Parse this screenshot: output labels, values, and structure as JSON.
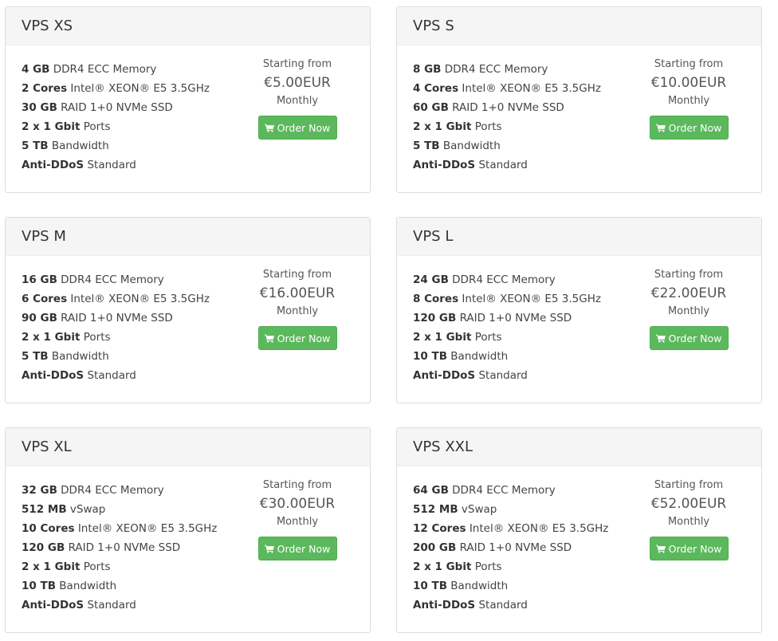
{
  "plans": [
    {
      "name": "VPS XS",
      "features": [
        {
          "value": "4 GB",
          "label": "DDR4 ECC Memory"
        },
        {
          "value": "2 Cores",
          "label": "Intel® XEON® E5 3.5GHz"
        },
        {
          "value": "30 GB",
          "label": "RAID 1+0 NVMe SSD"
        },
        {
          "value": "2 x 1 Gbit",
          "label": "Ports"
        },
        {
          "value": "5 TB",
          "label": "Bandwidth"
        },
        {
          "value": "Anti-DDoS",
          "label": "Standard"
        }
      ],
      "starting_from": "Starting from",
      "price": "€5.00EUR",
      "period": "Monthly",
      "order_label": "Order Now"
    },
    {
      "name": "VPS S",
      "features": [
        {
          "value": "8 GB",
          "label": "DDR4 ECC Memory"
        },
        {
          "value": "4 Cores",
          "label": "Intel® XEON® E5 3.5GHz"
        },
        {
          "value": "60 GB",
          "label": "RAID 1+0 NVMe SSD"
        },
        {
          "value": "2 x 1 Gbit",
          "label": "Ports"
        },
        {
          "value": "5 TB",
          "label": "Bandwidth"
        },
        {
          "value": "Anti-DDoS",
          "label": "Standard"
        }
      ],
      "starting_from": "Starting from",
      "price": "€10.00EUR",
      "period": "Monthly",
      "order_label": "Order Now"
    },
    {
      "name": "VPS M",
      "features": [
        {
          "value": "16 GB",
          "label": "DDR4 ECC Memory"
        },
        {
          "value": "6 Cores",
          "label": "Intel® XEON® E5 3.5GHz"
        },
        {
          "value": "90 GB",
          "label": "RAID 1+0 NVMe SSD"
        },
        {
          "value": "2 x 1 Gbit",
          "label": "Ports"
        },
        {
          "value": "5 TB",
          "label": "Bandwidth"
        },
        {
          "value": "Anti-DDoS",
          "label": "Standard"
        }
      ],
      "starting_from": "Starting from",
      "price": "€16.00EUR",
      "period": "Monthly",
      "order_label": "Order Now"
    },
    {
      "name": "VPS L",
      "features": [
        {
          "value": "24 GB",
          "label": "DDR4 ECC Memory"
        },
        {
          "value": "8 Cores",
          "label": "Intel® XEON® E5 3.5GHz"
        },
        {
          "value": "120 GB",
          "label": "RAID 1+0 NVMe SSD"
        },
        {
          "value": "2 x 1 Gbit",
          "label": "Ports"
        },
        {
          "value": "10 TB",
          "label": "Bandwidth"
        },
        {
          "value": "Anti-DDoS",
          "label": "Standard"
        }
      ],
      "starting_from": "Starting from",
      "price": "€22.00EUR",
      "period": "Monthly",
      "order_label": "Order Now"
    },
    {
      "name": "VPS XL",
      "features": [
        {
          "value": "32 GB",
          "label": "DDR4 ECC Memory"
        },
        {
          "value": "512 MB",
          "label": "vSwap"
        },
        {
          "value": "10 Cores",
          "label": "Intel® XEON® E5 3.5GHz"
        },
        {
          "value": "120 GB",
          "label": "RAID 1+0 NVMe SSD"
        },
        {
          "value": "2 x 1 Gbit",
          "label": "Ports"
        },
        {
          "value": "10 TB",
          "label": "Bandwidth"
        },
        {
          "value": "Anti-DDoS",
          "label": "Standard"
        }
      ],
      "starting_from": "Starting from",
      "price": "€30.00EUR",
      "period": "Monthly",
      "order_label": "Order Now"
    },
    {
      "name": "VPS XXL",
      "features": [
        {
          "value": "64 GB",
          "label": "DDR4 ECC Memory"
        },
        {
          "value": "512 MB",
          "label": "vSwap"
        },
        {
          "value": "12 Cores",
          "label": "Intel® XEON® E5 3.5GHz"
        },
        {
          "value": "200 GB",
          "label": "RAID 1+0 NVMe SSD"
        },
        {
          "value": "2 x 1 Gbit",
          "label": "Ports"
        },
        {
          "value": "10 TB",
          "label": "Bandwidth"
        },
        {
          "value": "Anti-DDoS",
          "label": "Standard"
        }
      ],
      "starting_from": "Starting from",
      "price": "€52.00EUR",
      "period": "Monthly",
      "order_label": "Order Now"
    }
  ],
  "icons": {
    "order": "shopping-cart-icon"
  },
  "colors": {
    "order_button": "#5cb85c",
    "panel_heading": "#f5f5f5",
    "panel_border": "#dddddd"
  }
}
